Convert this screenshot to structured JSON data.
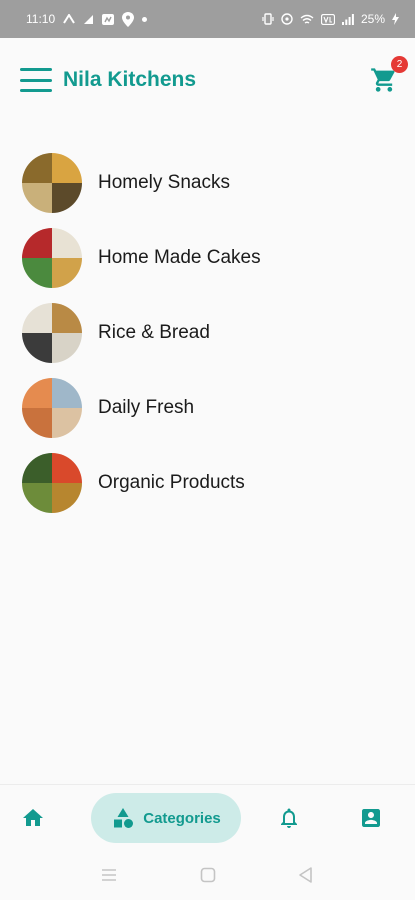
{
  "status_bar": {
    "time": "11:10",
    "battery": "25%"
  },
  "app_bar": {
    "title": "Nila Kitchens",
    "cart_count": "2"
  },
  "categories": [
    {
      "label": "Homely Snacks",
      "thumb_colors": [
        "#8a6a2c",
        "#d9a441",
        "#c9b07a",
        "#5c4a2a"
      ]
    },
    {
      "label": "Home Made Cakes",
      "thumb_colors": [
        "#b6292b",
        "#e8e2d4",
        "#4b8a3e",
        "#d1a24a"
      ]
    },
    {
      "label": "Rice & Bread",
      "thumb_colors": [
        "#e6e1d6",
        "#b98a45",
        "#3b3b3b",
        "#d8d3c7"
      ]
    },
    {
      "label": "Daily Fresh",
      "thumb_colors": [
        "#e58b4f",
        "#9fb7c9",
        "#c9723d",
        "#dcc2a2"
      ]
    },
    {
      "label": "Organic Products",
      "thumb_colors": [
        "#3b5e2a",
        "#d9492b",
        "#6d8c3a",
        "#b7862f"
      ]
    }
  ],
  "bottom_nav": {
    "active_label": "Categories"
  },
  "colors": {
    "accent": "#129a8f",
    "active_pill": "#cdebe8",
    "badge": "#e53935"
  }
}
